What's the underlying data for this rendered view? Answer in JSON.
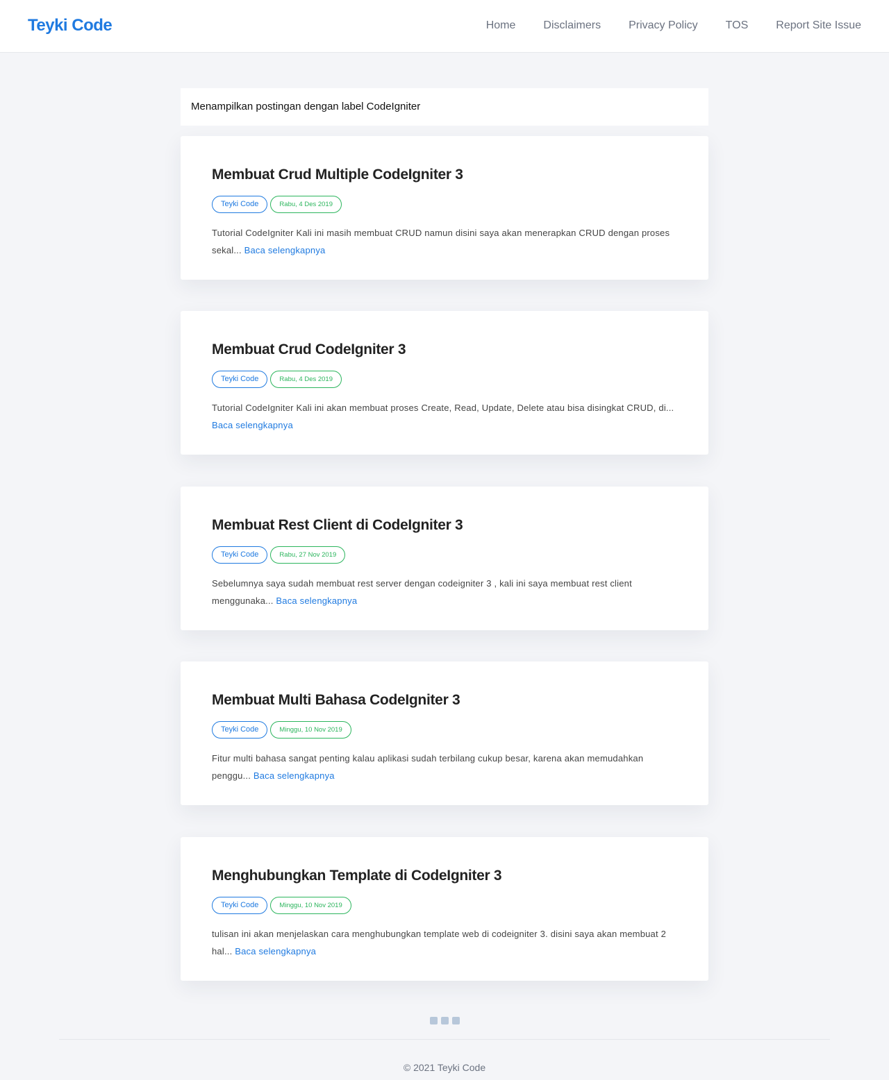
{
  "header": {
    "brand": "Teyki Code",
    "nav": [
      "Home",
      "Disclaimers",
      "Privacy Policy",
      "TOS",
      "Report Site Issue"
    ]
  },
  "label_banner": "Menampilkan postingan dengan label CodeIgniter",
  "posts": [
    {
      "title": "Membuat Crud Multiple CodeIgniter 3",
      "author": "Teyki Code",
      "date": "Rabu, 4 Des 2019",
      "excerpt": "Tutorial CodeIgniter Kali ini masih membuat CRUD namun disini saya akan menerapkan CRUD dengan proses sekal...",
      "read_more": "Baca selengkapnya"
    },
    {
      "title": "Membuat Crud CodeIgniter 3",
      "author": "Teyki Code",
      "date": "Rabu, 4 Des 2019",
      "excerpt": "Tutorial CodeIgniter Kali ini akan membuat proses Create, Read, Update, Delete atau bisa disingkat CRUD, di...",
      "read_more": "Baca selengkapnya"
    },
    {
      "title": "Membuat Rest Client di CodeIgniter 3",
      "author": "Teyki Code",
      "date": "Rabu, 27 Nov 2019",
      "excerpt": "Sebelumnya saya sudah membuat rest server dengan codeigniter 3 , kali ini saya membuat rest client menggunaka...",
      "read_more": "Baca selengkapnya"
    },
    {
      "title": "Membuat Multi Bahasa CodeIgniter 3",
      "author": "Teyki Code",
      "date": "Minggu, 10 Nov 2019",
      "excerpt": "Fitur multi bahasa sangat penting kalau aplikasi sudah terbilang cukup besar, karena akan memudahkan penggu...",
      "read_more": "Baca selengkapnya"
    },
    {
      "title": "Menghubungkan Template di CodeIgniter 3",
      "author": "Teyki Code",
      "date": "Minggu, 10 Nov 2019",
      "excerpt": "tulisan ini akan menjelaskan cara menghubungkan template web di codeigniter 3. disini saya akan membuat 2 hal...",
      "read_more": "Baca selengkapnya"
    }
  ],
  "footer": "© 2021 Teyki Code"
}
